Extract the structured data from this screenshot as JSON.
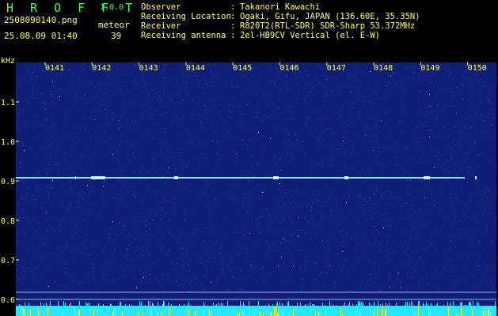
{
  "app": {
    "title": "H R O F F T",
    "version": "1.0.0"
  },
  "file": {
    "name": "2508090140.png",
    "datetime": "25.08.09 01:40"
  },
  "meteor": {
    "label": "meteor",
    "count": "39"
  },
  "meta": {
    "observer_label": "Observer",
    "observer_value": "Takanori Kawachi",
    "location_label": "Receiving Location",
    "location_value": "Ogaki, Gifu, JAPAN (136.60E, 35.35N)",
    "receiver_label": "Receiver",
    "receiver_value": "R820T2(RTL-SDR) SDR-Sharp 53.372MHz",
    "antenna_label": "Receiving antenna",
    "antenna_value": "2el-HB9CV Vertical (el. E-W)"
  },
  "axis": {
    "y_unit": "kHz",
    "y_ticks": [
      "1.1",
      "1.0",
      "0.9",
      "0.8",
      "0.7",
      "0.6"
    ],
    "x_ticks": [
      "0141",
      "0142",
      "0143",
      "0144",
      "0145",
      "0146",
      "0147",
      "0148",
      "0149",
      "0150"
    ]
  },
  "colors": {
    "background": "#0f1f78",
    "signal": "#9ff7ff",
    "label": "#ffff66",
    "accent": "#47ff47",
    "cyan": "#25e7ff"
  }
}
